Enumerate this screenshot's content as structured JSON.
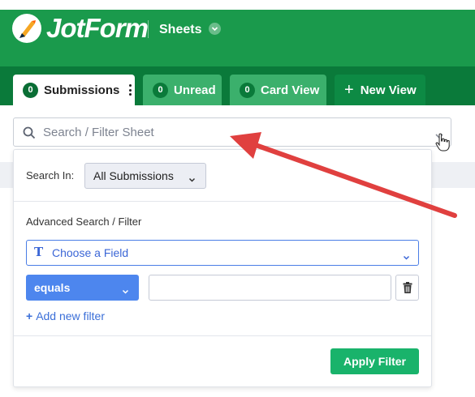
{
  "app": {
    "logo_text": "JotForm",
    "section_label": "Sheets"
  },
  "tabs": [
    {
      "count": "0",
      "label": "Submissions",
      "active": true
    },
    {
      "count": "0",
      "label": "Unread",
      "active": false
    },
    {
      "count": "0",
      "label": "Card View",
      "active": false
    },
    {
      "label": "New View"
    }
  ],
  "search": {
    "placeholder": "Search / Filter Sheet"
  },
  "filter_panel": {
    "search_in_label": "Search In:",
    "search_in_value": "All Submissions",
    "advanced_label": "Advanced Search / Filter",
    "field_type_icon": "T",
    "field_placeholder": "Choose a Field",
    "operator_value": "equals",
    "filter_value": "",
    "add_filter_plus": "+",
    "add_filter_label": "Add new filter",
    "apply_label": "Apply Filter"
  },
  "icons": [
    "jotform-logo-icon",
    "chevron-down-icon",
    "search-icon",
    "trash-icon",
    "kebab-menu-icon",
    "plus-icon",
    "hand-cursor-icon",
    "annotation-arrow"
  ],
  "colors": {
    "header_green": "#1a9a4c",
    "tabbar_green": "#0a7a3a",
    "accent_blue": "#4d86ee",
    "apply_green": "#19b36b",
    "annotation_red": "#e0403f"
  }
}
